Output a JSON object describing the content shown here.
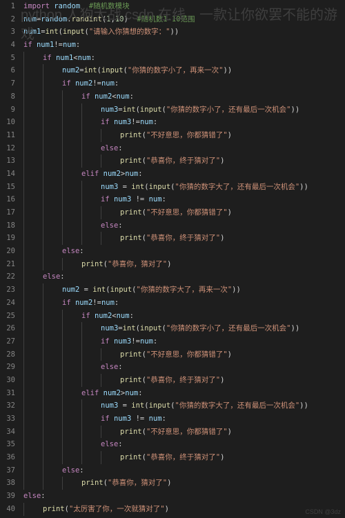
{
  "title_overlay": "python 人狗大战 csdn 在线，一款让你欲罢不能的游戏",
  "watermark": "CSDN @3dz",
  "lines": [
    {
      "n": 1,
      "indent": 0,
      "html": "<span class='kw'>import</span> <span class='var'>random</span>  <span class='cmt'>#随机数模块</span>"
    },
    {
      "n": 2,
      "indent": 0,
      "html": "<span class='var'>num</span>=<span class='var'>random</span>.<span class='fn'>randint</span>(<span class='num'>1</span>,<span class='num'>10</span>)  <span class='cmt'>#随机数1-10范围</span>"
    },
    {
      "n": 3,
      "indent": 0,
      "html": "<span class='var'>num1</span>=<span class='fn'>int</span>(<span class='fn'>input</span>(<span class='str'>\"请输入你猜想的数字：\"</span>))"
    },
    {
      "n": 4,
      "indent": 0,
      "html": "<span class='kw'>if</span> <span class='var'>num1</span>!=<span class='var'>num</span>:"
    },
    {
      "n": 5,
      "indent": 1,
      "html": "<span class='kw'>if</span> <span class='var'>num1</span>&lt;<span class='var'>num</span>:"
    },
    {
      "n": 6,
      "indent": 2,
      "html": "<span class='var'>num2</span>=<span class='fn'>int</span>(<span class='fn'>input</span>(<span class='str'>\"你猜的数字小了，再来一次\"</span>))"
    },
    {
      "n": 7,
      "indent": 2,
      "html": "<span class='kw'>if</span> <span class='var'>num2</span>!=<span class='var'>num</span>:"
    },
    {
      "n": 8,
      "indent": 3,
      "html": "<span class='kw'>if</span> <span class='var'>num2</span>&lt;<span class='var'>num</span>:"
    },
    {
      "n": 9,
      "indent": 4,
      "html": "<span class='var'>num3</span>=<span class='fn'>int</span>(<span class='fn'>input</span>(<span class='str'>\"你猜的数字小了，还有最后一次机会\"</span>))"
    },
    {
      "n": 10,
      "indent": 4,
      "html": "<span class='kw'>if</span> <span class='var'>num3</span>!=<span class='var'>num</span>:"
    },
    {
      "n": 11,
      "indent": 5,
      "html": "<span class='fn'>print</span>(<span class='str'>\"不好意思，你都猜错了\"</span>)"
    },
    {
      "n": 12,
      "indent": 4,
      "html": "<span class='kw'>else</span>:"
    },
    {
      "n": 13,
      "indent": 5,
      "html": "<span class='fn'>print</span>(<span class='str'>\"恭喜你，终于猜对了\"</span>)"
    },
    {
      "n": 14,
      "indent": 3,
      "html": "<span class='kw'>elif</span> <span class='var'>num2</span>&gt;<span class='var'>num</span>:"
    },
    {
      "n": 15,
      "indent": 4,
      "html": "<span class='var'>num3</span> = <span class='fn'>int</span>(<span class='fn'>input</span>(<span class='str'>\"你猜的数字大了，还有最后一次机会\"</span>))"
    },
    {
      "n": 16,
      "indent": 4,
      "html": "<span class='kw'>if</span> <span class='var'>num3</span> != <span class='var'>num</span>:"
    },
    {
      "n": 17,
      "indent": 5,
      "html": "<span class='fn'>print</span>(<span class='str'>\"不好意思，你都猜错了\"</span>)"
    },
    {
      "n": 18,
      "indent": 4,
      "html": "<span class='kw'>else</span>:"
    },
    {
      "n": 19,
      "indent": 5,
      "html": "<span class='fn'>print</span>(<span class='str'>\"恭喜你，终于猜对了\"</span>)"
    },
    {
      "n": 20,
      "indent": 2,
      "html": "<span class='kw'>else</span>:"
    },
    {
      "n": 21,
      "indent": 3,
      "html": "<span class='fn'>print</span>(<span class='str'>\"恭喜你，猜对了\"</span>)"
    },
    {
      "n": 22,
      "indent": 1,
      "html": "<span class='kw'>else</span>:"
    },
    {
      "n": 23,
      "indent": 2,
      "html": "<span class='var'>num2</span> = <span class='fn'>int</span>(<span class='fn'>input</span>(<span class='str'>\"你猜的数字大了，再来一次\"</span>))"
    },
    {
      "n": 24,
      "indent": 2,
      "html": "<span class='kw'>if</span> <span class='var'>num2</span>!=<span class='var'>num</span>:"
    },
    {
      "n": 25,
      "indent": 3,
      "html": "<span class='kw'>if</span> <span class='var'>num2</span>&lt;<span class='var'>num</span>:"
    },
    {
      "n": 26,
      "indent": 4,
      "html": "<span class='var'>num3</span>=<span class='fn'>int</span>(<span class='fn'>input</span>(<span class='str'>\"你猜的数字小了，还有最后一次机会\"</span>))"
    },
    {
      "n": 27,
      "indent": 4,
      "html": "<span class='kw'>if</span> <span class='var'>num3</span>!=<span class='var'>num</span>:"
    },
    {
      "n": 28,
      "indent": 5,
      "html": "<span class='fn'>print</span>(<span class='str'>\"不好意思，你都猜错了\"</span>)"
    },
    {
      "n": 29,
      "indent": 4,
      "html": "<span class='kw'>else</span>:"
    },
    {
      "n": 30,
      "indent": 5,
      "html": "<span class='fn'>print</span>(<span class='str'>\"恭喜你，终于猜对了\"</span>)"
    },
    {
      "n": 31,
      "indent": 3,
      "html": "<span class='kw'>elif</span> <span class='var'>num2</span>&gt;<span class='var'>num</span>:"
    },
    {
      "n": 32,
      "indent": 4,
      "html": "<span class='var'>num3</span> = <span class='fn'>int</span>(<span class='fn'>input</span>(<span class='str'>\"你猜的数字大了，还有最后一次机会\"</span>))"
    },
    {
      "n": 33,
      "indent": 4,
      "html": "<span class='kw'>if</span> <span class='var'>num3</span> != <span class='var'>num</span>:"
    },
    {
      "n": 34,
      "indent": 5,
      "html": "<span class='fn'>print</span>(<span class='str'>\"不好意思，你都猜错了\"</span>)"
    },
    {
      "n": 35,
      "indent": 4,
      "html": "<span class='kw'>else</span>:"
    },
    {
      "n": 36,
      "indent": 5,
      "html": "<span class='fn'>print</span>(<span class='str'>\"恭喜你，终于猜对了\"</span>)"
    },
    {
      "n": 37,
      "indent": 2,
      "html": "<span class='kw'>else</span>:"
    },
    {
      "n": 38,
      "indent": 3,
      "html": "<span class='fn'>print</span>(<span class='str'>\"恭喜你，猜对了\"</span>)"
    },
    {
      "n": 39,
      "indent": 0,
      "html": "<span class='kw'>else</span>:"
    },
    {
      "n": 40,
      "indent": 1,
      "html": "<span class='fn'>print</span>(<span class='str'>\"太厉害了你，一次就猜对了\"</span>)"
    }
  ]
}
